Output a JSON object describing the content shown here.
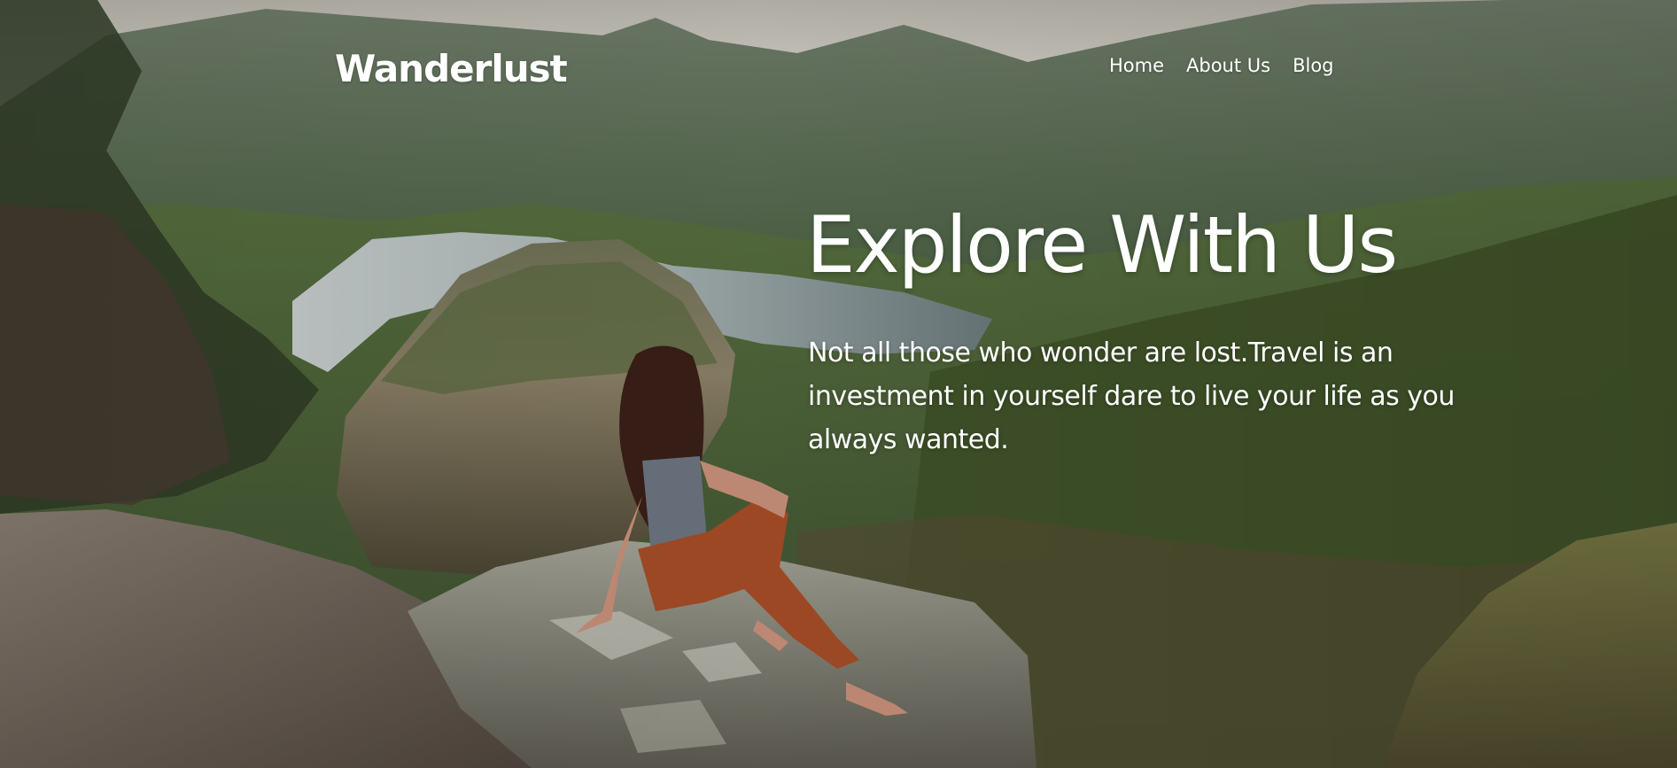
{
  "brand": {
    "name": "Wanderlust"
  },
  "nav": {
    "items": [
      {
        "label": "Home"
      },
      {
        "label": "About Us"
      },
      {
        "label": "Blog"
      }
    ]
  },
  "hero": {
    "headline": "Explore With Us",
    "tagline": "Not all those who wonder are lost.Travel is an investment in yourself dare to live your life as you always wanted.",
    "background_image": "mountain-canyon-woman-on-cliff-photo"
  },
  "colors": {
    "text": "#ffffff",
    "sky": "#d9d6cf",
    "mountain_far": "#5f7160",
    "mountain_mid": "#4f6a44",
    "river": "#9aa7a8",
    "rock": "#8d8f86",
    "pants": "#a64d26"
  }
}
